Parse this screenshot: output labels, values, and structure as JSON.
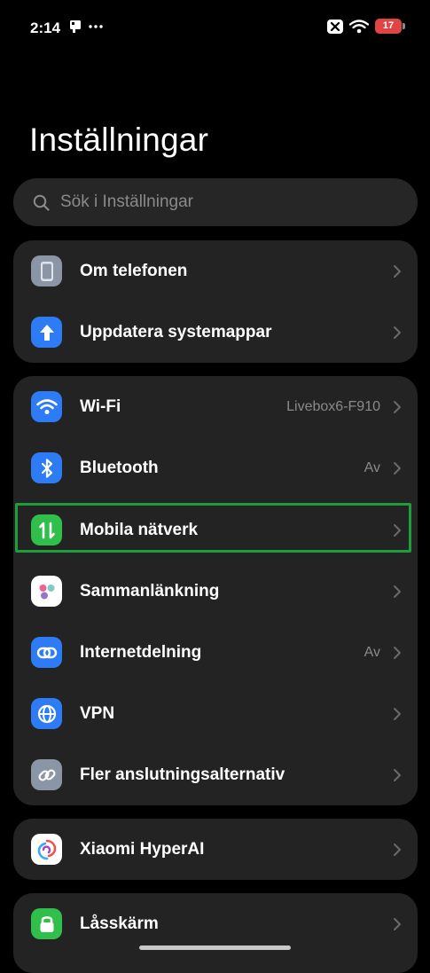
{
  "status_bar": {
    "time": "2:14",
    "battery": "17"
  },
  "page": {
    "title": "Inställningar"
  },
  "search": {
    "placeholder": "Sök i Inställningar"
  },
  "groups": [
    {
      "items": [
        {
          "label": "Om telefonen",
          "value": "",
          "icon": "phone-icon",
          "color": "#8a96a6"
        },
        {
          "label": "Uppdatera systemappar",
          "value": "",
          "icon": "arrow-up-icon",
          "color": "#2d7cf6"
        }
      ]
    },
    {
      "items": [
        {
          "label": "Wi-Fi",
          "value": "Livebox6-F910",
          "icon": "wifi-icon",
          "color": "#2d7cf6"
        },
        {
          "label": "Bluetooth",
          "value": "Av",
          "icon": "bluetooth-icon",
          "color": "#2d7cf6"
        },
        {
          "label": "Mobila nätverk",
          "value": "",
          "icon": "mobile-data-icon",
          "color": "#2fbf4a"
        },
        {
          "label": "Sammanlänkning",
          "value": "",
          "icon": "interconnect-icon",
          "color": "#ffffff"
        },
        {
          "label": "Internetdelning",
          "value": "Av",
          "icon": "hotspot-icon",
          "color": "#2d7cf6"
        },
        {
          "label": "VPN",
          "value": "",
          "icon": "globe-icon",
          "color": "#2d7cf6"
        },
        {
          "label": "Fler anslutningsalternativ",
          "value": "",
          "icon": "link-icon",
          "color": "#8a96a6"
        }
      ]
    },
    {
      "items": [
        {
          "label": "Xiaomi HyperAI",
          "value": "",
          "icon": "hyperai-icon",
          "color": "#ffffff"
        }
      ]
    },
    {
      "items": [
        {
          "label": "Låsskärm",
          "value": "",
          "icon": "lock-icon",
          "color": "#2fbf4a"
        }
      ]
    }
  ],
  "highlight_color": "#1e9e3a"
}
